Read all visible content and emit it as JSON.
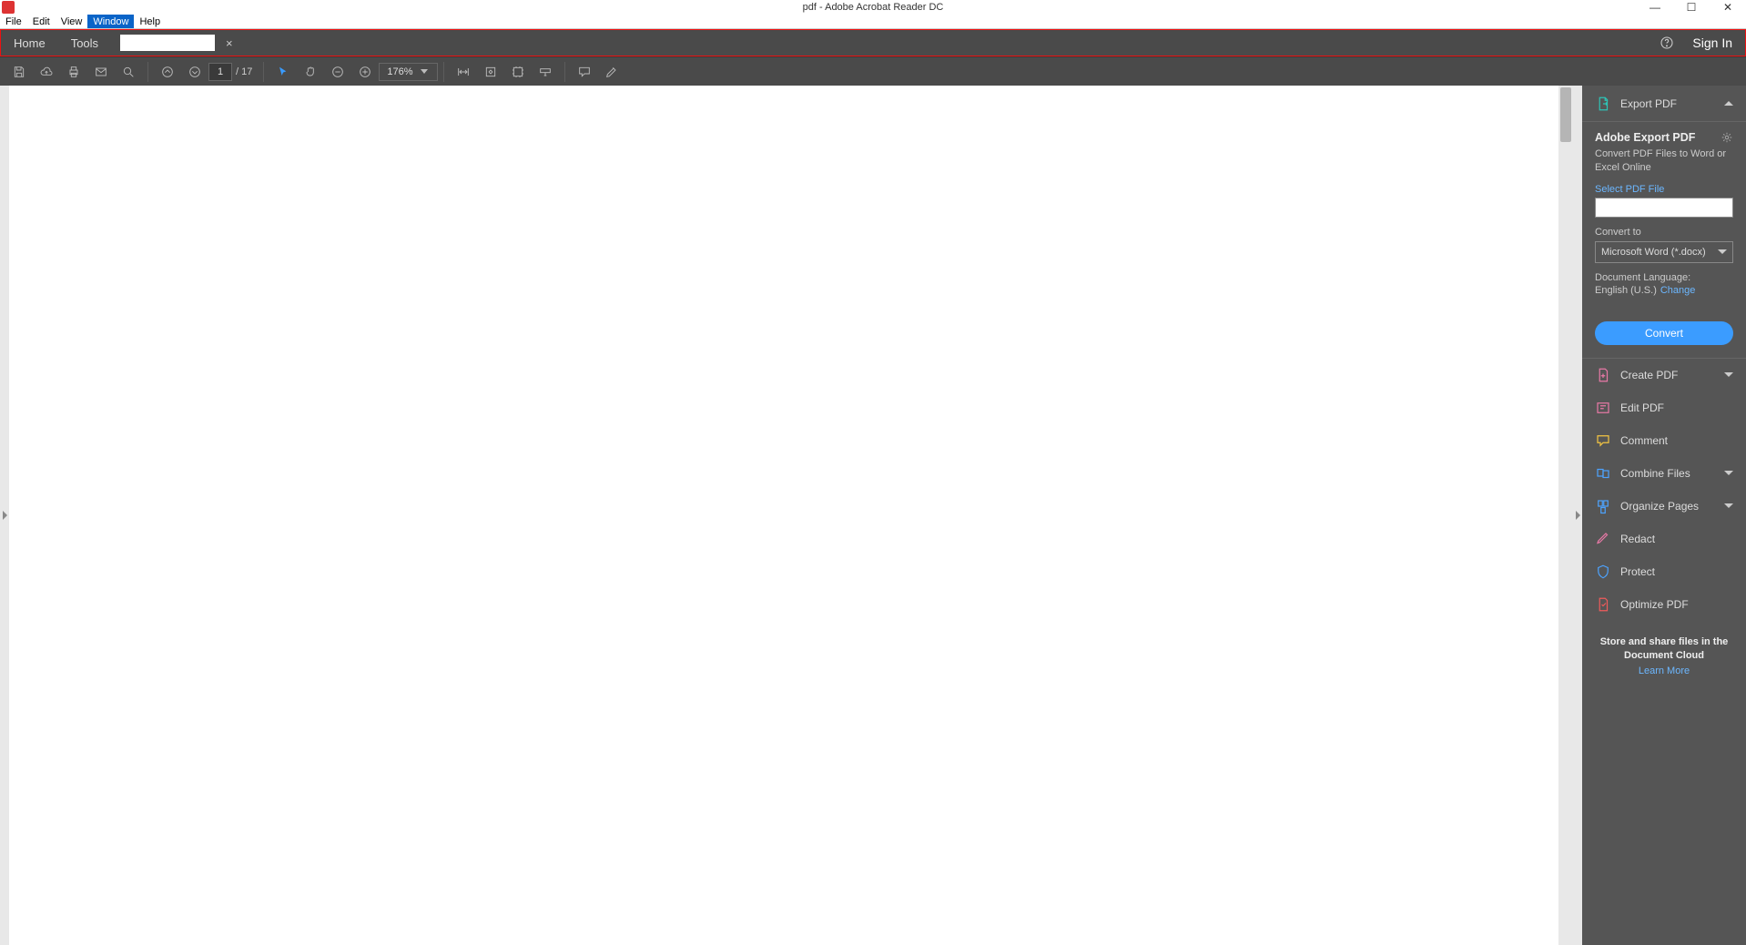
{
  "titlebar": {
    "title": "pdf - Adobe Acrobat Reader DC"
  },
  "menubar": {
    "items": [
      "File",
      "Edit",
      "View",
      "Window",
      "Help"
    ],
    "active_index": 3
  },
  "tabbar": {
    "home": "Home",
    "tools": "Tools",
    "signin": "Sign In"
  },
  "toolbar": {
    "page_current": "1",
    "page_sep": "/",
    "page_total": "17",
    "zoom": "176%"
  },
  "rpanel": {
    "export_head": "Export PDF",
    "export_title": "Adobe Export PDF",
    "export_desc": "Convert PDF Files to Word or Excel Online",
    "select_label": "Select PDF File",
    "convert_to_label": "Convert to",
    "convert_to_value": "Microsoft Word (*.docx)",
    "lang_label": "Document Language:",
    "lang_value": "English (U.S.)",
    "lang_change": "Change",
    "convert_btn": "Convert",
    "tools": [
      {
        "label": "Create PDF",
        "chev": true
      },
      {
        "label": "Edit PDF",
        "chev": false
      },
      {
        "label": "Comment",
        "chev": false
      },
      {
        "label": "Combine Files",
        "chev": true
      },
      {
        "label": "Organize Pages",
        "chev": true
      },
      {
        "label": "Redact",
        "chev": false
      },
      {
        "label": "Protect",
        "chev": false
      },
      {
        "label": "Optimize PDF",
        "chev": false
      }
    ],
    "footer_text": "Store and share files in the Document Cloud",
    "footer_learn": "Learn More"
  }
}
